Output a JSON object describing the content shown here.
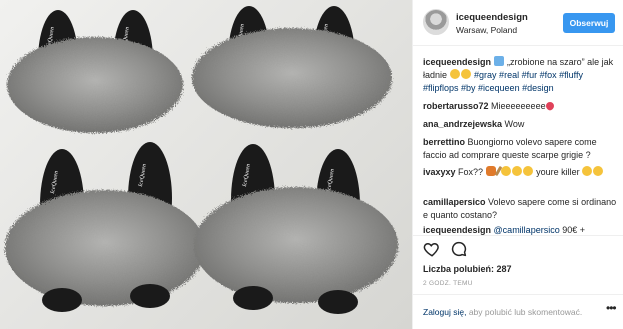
{
  "header": {
    "username": "icequeendesign",
    "location": "Warsaw, Poland",
    "follow_label": "Obserwuj"
  },
  "caption": {
    "author": "icequeendesign",
    "text_1": " „zrobione na szaro” ale jak ładnie ",
    "tags": "#gray #real #fur #fox #fluffy #flipflops #by #icequeen #design"
  },
  "comments": [
    {
      "author": "robertarusso72",
      "text": " Mieeeeeeeee"
    },
    {
      "author": "ana_andrzejewska",
      "text": " Wow"
    },
    {
      "author": "berrettino",
      "text": " Buongiorno volevo sapere come faccio ad comprare queste scarpe grigie ?"
    },
    {
      "author": "ivaxyxy",
      "text": " Fox?? ",
      "text_after": " youre killer"
    },
    {
      "author": "camillapersico",
      "text": " Volevo sapere come si ordinano e quanto costano?"
    },
    {
      "author": "icequeendesign",
      "mention": "@camillapersico",
      "text": " 90€ +"
    }
  ],
  "actions": {
    "like_icon": "heart-icon",
    "comment_icon": "comment-bubble-icon"
  },
  "likes": {
    "label": "Liczba polubień:",
    "count": "287"
  },
  "time": "2 GODZ. TEMU",
  "login": {
    "link": "Zaloguj się,",
    "text": " aby polubić lub skomentować."
  },
  "photo": {
    "brand_label": "IceQueen",
    "fur_color": "#8e8e8c",
    "sole_color": "#1a1a1a"
  }
}
